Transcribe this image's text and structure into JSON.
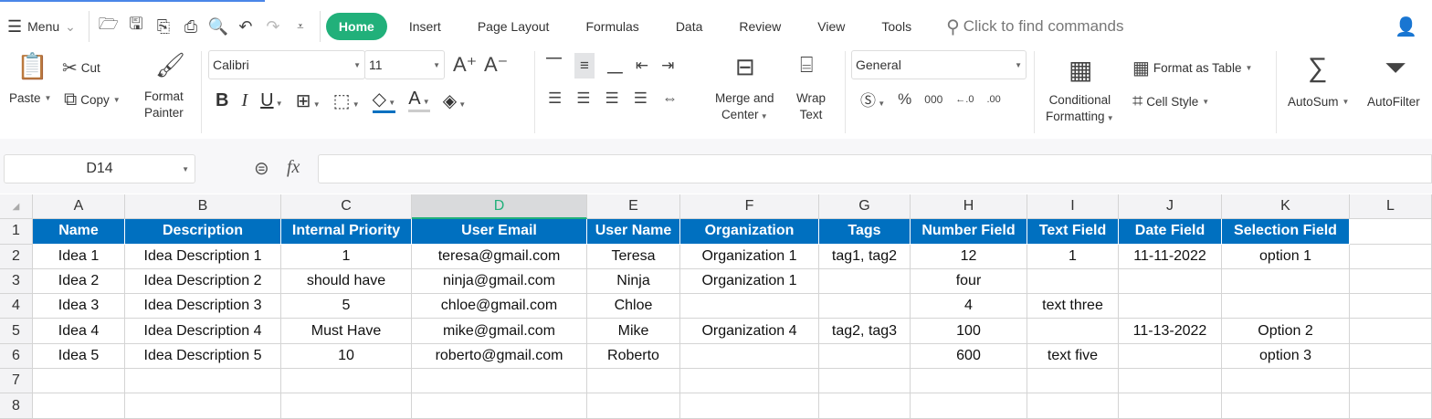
{
  "menubar": {
    "menu_label": "Menu",
    "tabs": [
      "Home",
      "Insert",
      "Page Layout",
      "Formulas",
      "Data",
      "Review",
      "View",
      "Tools"
    ],
    "active_tab": "Home",
    "search_placeholder": "Click to find commands"
  },
  "ribbon": {
    "paste": "Paste",
    "cut": "Cut",
    "copy": "Copy",
    "format_painter_1": "Format",
    "format_painter_2": "Painter",
    "font_name": "Calibri",
    "font_size": "11",
    "merge_1": "Merge and",
    "merge_2": "Center",
    "wrap_1": "Wrap",
    "wrap_2": "Text",
    "number_format": "General",
    "conditional_1": "Conditional",
    "conditional_2": "Formatting",
    "format_as_table": "Format as Table",
    "cell_style": "Cell Style",
    "autosum": "AutoSum",
    "autofilter": "AutoFilter"
  },
  "formula_bar": {
    "cell_ref": "D14",
    "fx": "fx",
    "value": ""
  },
  "sheet": {
    "columns": [
      "A",
      "B",
      "C",
      "D",
      "E",
      "F",
      "G",
      "H",
      "I",
      "J",
      "K",
      "L"
    ],
    "selected_column": "D",
    "row_numbers": [
      "1",
      "2",
      "3",
      "4",
      "5",
      "6",
      "7",
      "8"
    ],
    "header": [
      "Name",
      "Description",
      "Internal Priority",
      "User Email",
      "User Name",
      "Organization",
      "Tags",
      "Number Field",
      "Text Field",
      "Date Field",
      "Selection Field"
    ],
    "rows": [
      [
        "Idea 1",
        "Idea Description 1",
        "1",
        "teresa@gmail.com",
        "Teresa",
        "Organization 1",
        "tag1, tag2",
        "12",
        "1",
        "11-11-2022",
        "option 1"
      ],
      [
        "Idea 2",
        "Idea Description 2",
        "should have",
        "ninja@gmail.com",
        "Ninja",
        "Organization 1",
        "",
        "four",
        "",
        "",
        ""
      ],
      [
        "Idea 3",
        "Idea Description 3",
        "5",
        "chloe@gmail.com",
        "Chloe",
        "",
        "",
        "4",
        "text three",
        "",
        ""
      ],
      [
        "Idea 4",
        "Idea Description 4",
        "Must Have",
        "mike@gmail.com",
        "Mike",
        "Organization 4",
        "tag2, tag3",
        "100",
        "",
        "11-13-2022",
        "Option 2"
      ],
      [
        "Idea 5",
        "Idea Description 5",
        "10",
        "roberto@gmail.com",
        "Roberto",
        "",
        "",
        "600",
        "text five",
        "",
        "option 3"
      ]
    ],
    "header_fill": "#0070c0"
  }
}
